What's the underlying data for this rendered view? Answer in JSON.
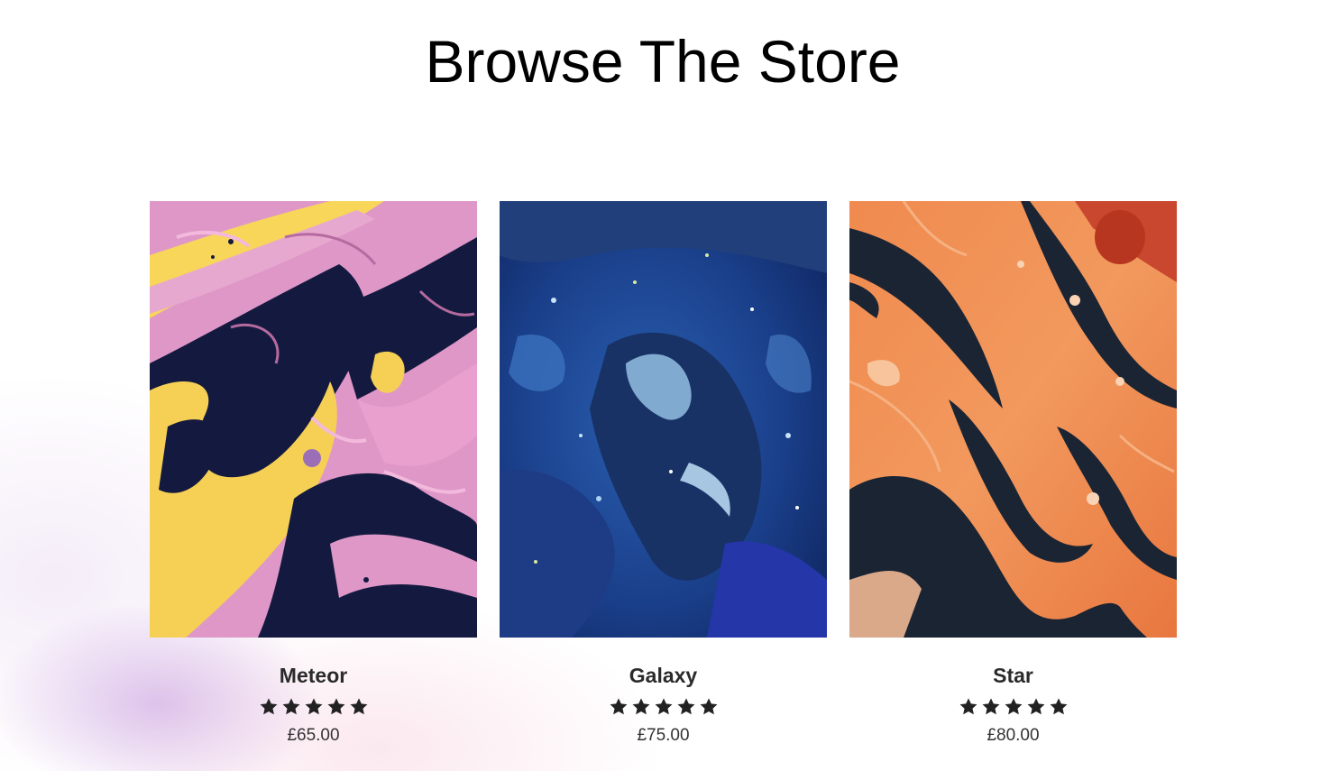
{
  "page": {
    "title": "Browse The Store"
  },
  "products": [
    {
      "name": "Meteor",
      "rating": 5,
      "price": "£65.00",
      "image": "pink-yellow-navy-marble-art"
    },
    {
      "name": "Galaxy",
      "rating": 5,
      "price": "£75.00",
      "image": "blue-galaxy-texture-art"
    },
    {
      "name": "Star",
      "rating": 5,
      "price": "£80.00",
      "image": "orange-navy-fluid-art"
    }
  ],
  "colors": {
    "star": "#222222",
    "title": "#000000",
    "accent_glow": "#c496dc"
  }
}
